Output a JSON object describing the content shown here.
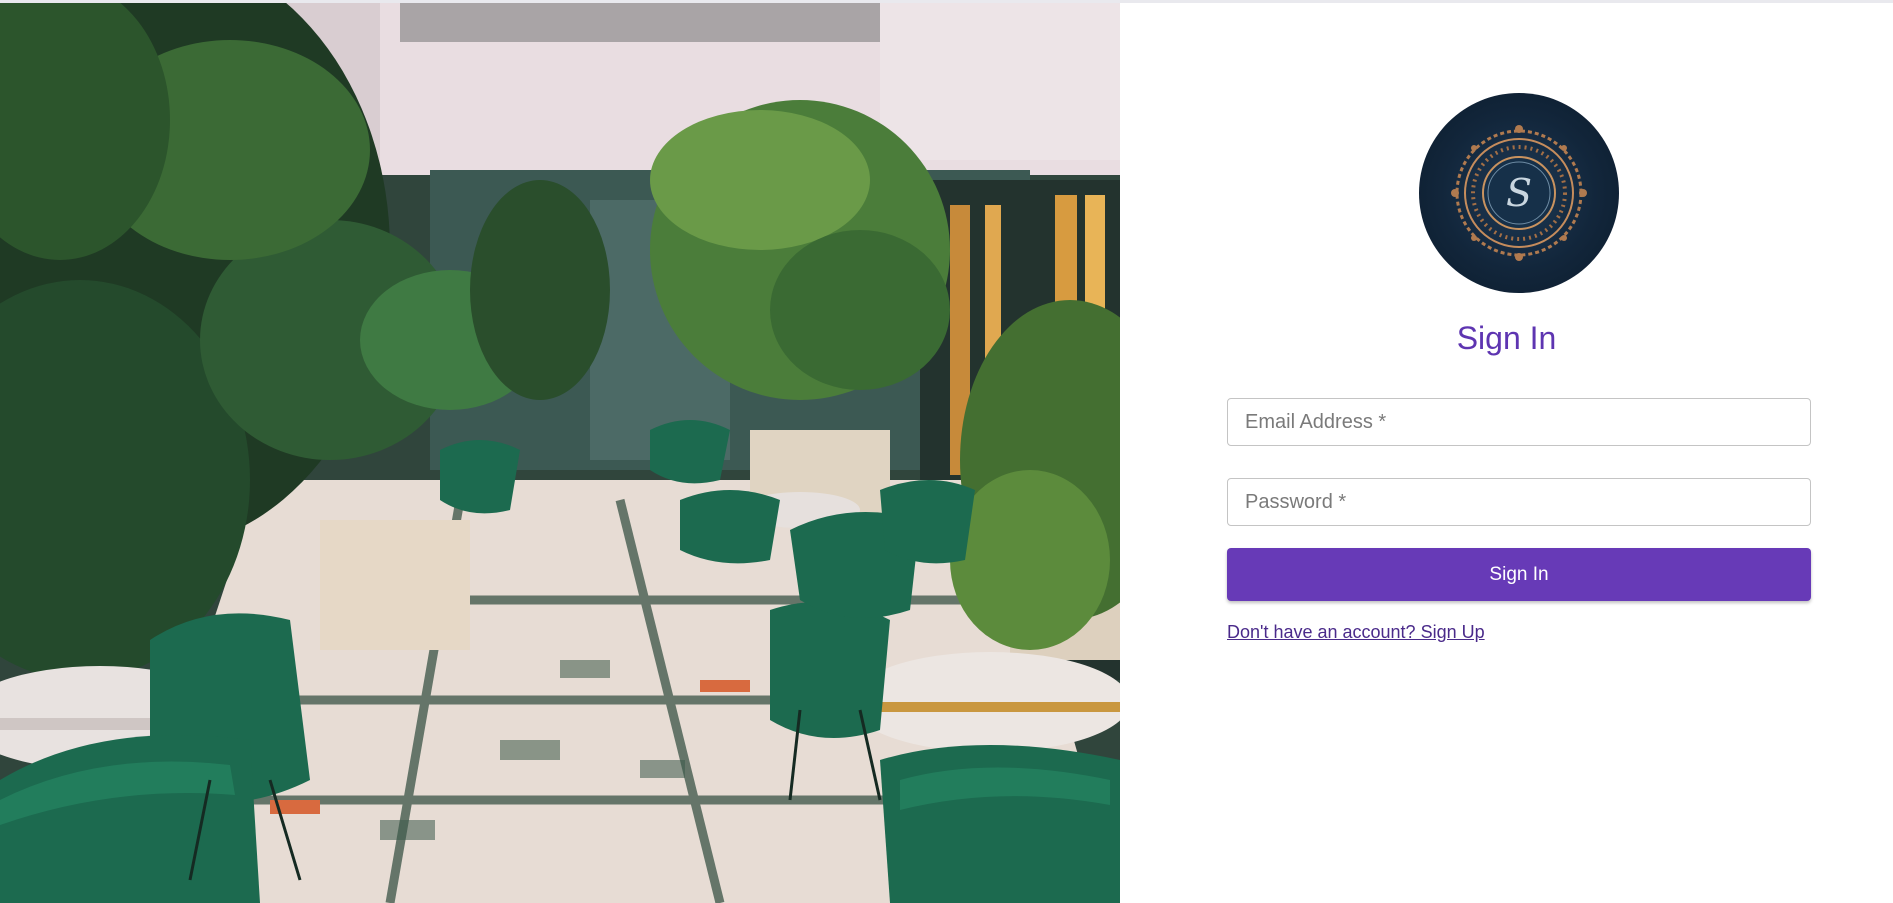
{
  "hero": {
    "image_name": "courtyard-cafe-photo"
  },
  "logo": {
    "monogram": "S"
  },
  "form": {
    "title": "Sign In",
    "email_placeholder": "Email Address *",
    "password_placeholder": "Password *",
    "submit_label": "Sign In",
    "signup_link": "Don't have an account? Sign Up"
  },
  "colors": {
    "accent": "#673ab7",
    "title": "#5e35b1",
    "link": "#4a2a8a",
    "logo_bg": "#12263b",
    "logo_ornament": "#b07a4f"
  }
}
